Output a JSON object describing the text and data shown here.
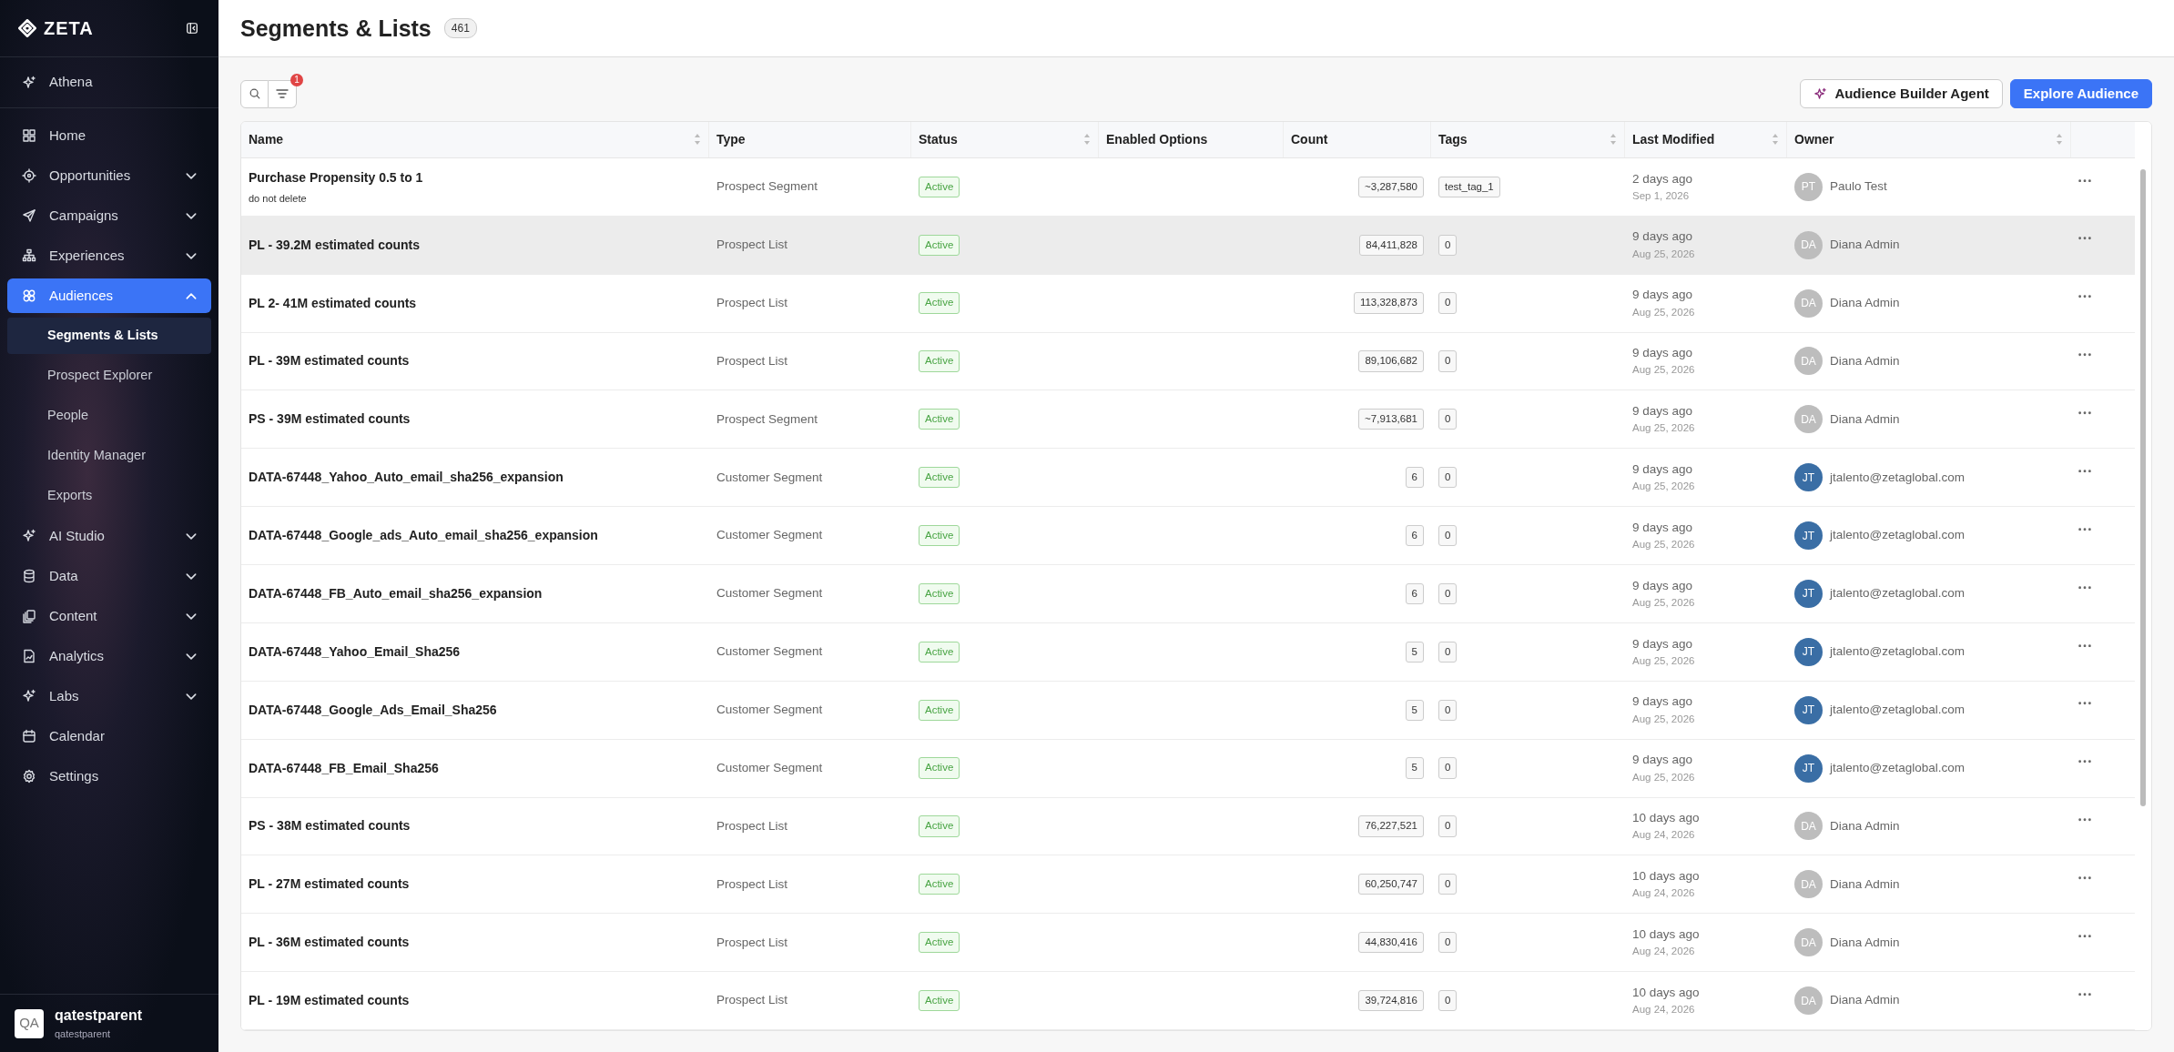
{
  "sidebar": {
    "brand": "ZETA",
    "top_item": {
      "label": "Athena"
    },
    "items": [
      {
        "label": "Home",
        "kind": "link",
        "selected": false
      },
      {
        "label": "Opportunities",
        "kind": "group",
        "expanded": false,
        "selected": false
      },
      {
        "label": "Campaigns",
        "kind": "group",
        "expanded": false,
        "selected": false
      },
      {
        "label": "Experiences",
        "kind": "group",
        "expanded": false,
        "selected": false
      },
      {
        "label": "Audiences",
        "kind": "group",
        "expanded": true,
        "selected": true,
        "children": [
          {
            "label": "Segments & Lists",
            "selected": true
          },
          {
            "label": "Prospect Explorer",
            "selected": false
          },
          {
            "label": "People",
            "selected": false
          },
          {
            "label": "Identity Manager",
            "selected": false
          },
          {
            "label": "Exports",
            "selected": false
          }
        ]
      },
      {
        "label": "AI Studio",
        "kind": "group",
        "expanded": false,
        "selected": false
      },
      {
        "label": "Data",
        "kind": "group",
        "expanded": false,
        "selected": false
      },
      {
        "label": "Content",
        "kind": "group",
        "expanded": false,
        "selected": false
      },
      {
        "label": "Analytics",
        "kind": "group",
        "expanded": false,
        "selected": false
      },
      {
        "label": "Labs",
        "kind": "group",
        "expanded": false,
        "selected": false
      },
      {
        "label": "Calendar",
        "kind": "link",
        "selected": false
      },
      {
        "label": "Settings",
        "kind": "link",
        "selected": false
      }
    ],
    "user": {
      "initials": "QA",
      "name": "qatestparent",
      "org": "qatestparent"
    }
  },
  "page": {
    "title": "Segments & Lists",
    "count": "461",
    "filter_count": "1",
    "buttons": [
      {
        "label": "Audience Builder Agent",
        "kind": "secondary"
      },
      {
        "label": "Explore Audience",
        "kind": "primary"
      }
    ]
  },
  "table": {
    "columns": [
      {
        "label": "Name",
        "sortable": true
      },
      {
        "label": "Type",
        "sortable": false
      },
      {
        "label": "Status",
        "sortable": true
      },
      {
        "label": "Enabled Options",
        "sortable": false
      },
      {
        "label": "Count",
        "sortable": false
      },
      {
        "label": "Tags",
        "sortable": true
      },
      {
        "label": "Last Modified",
        "sortable": true
      },
      {
        "label": "Owner",
        "sortable": true
      }
    ],
    "rows": [
      {
        "name": "Purchase Propensity 0.5 to 1",
        "note": "do not delete",
        "type": "Prospect Segment",
        "status": "Active",
        "count": "~3,287,580",
        "tag": "test_tag_1",
        "modified": "2 days ago",
        "date": "Sep 1, 2026",
        "initials": "PT",
        "owner": "Paulo Test",
        "color": "#bdbdbd",
        "hovered": false
      },
      {
        "name": "PL - 39.2M estimated counts",
        "type": "Prospect List",
        "status": "Active",
        "count": "84,411,828",
        "tag": "0",
        "modified": "9 days ago",
        "date": "Aug 25, 2026",
        "initials": "DA",
        "owner": "Diana Admin",
        "color": "#bdbdbd",
        "hovered": true
      },
      {
        "name": "PL 2- 41M estimated counts",
        "type": "Prospect List",
        "status": "Active",
        "count": "113,328,873",
        "tag": "0",
        "modified": "9 days ago",
        "date": "Aug 25, 2026",
        "initials": "DA",
        "owner": "Diana Admin",
        "color": "#bdbdbd",
        "hovered": false
      },
      {
        "name": "PL - 39M estimated counts",
        "type": "Prospect List",
        "status": "Active",
        "count": "89,106,682",
        "tag": "0",
        "modified": "9 days ago",
        "date": "Aug 25, 2026",
        "initials": "DA",
        "owner": "Diana Admin",
        "color": "#bdbdbd",
        "hovered": false
      },
      {
        "name": "PS - 39M estimated counts",
        "type": "Prospect Segment",
        "status": "Active",
        "count": "~7,913,681",
        "tag": "0",
        "modified": "9 days ago",
        "date": "Aug 25, 2026",
        "initials": "DA",
        "owner": "Diana Admin",
        "color": "#bdbdbd",
        "hovered": false
      },
      {
        "name": "DATA-67448_Yahoo_Auto_email_sha256_expansion",
        "type": "Customer Segment",
        "status": "Active",
        "count": "6",
        "tag": "0",
        "modified": "9 days ago",
        "date": "Aug 25, 2026",
        "initials": "JT",
        "owner": "jtalento@zetaglobal.com",
        "color": "#3a6ea5",
        "hovered": false
      },
      {
        "name": "DATA-67448_Google_ads_Auto_email_sha256_expansion",
        "type": "Customer Segment",
        "status": "Active",
        "count": "6",
        "tag": "0",
        "modified": "9 days ago",
        "date": "Aug 25, 2026",
        "initials": "JT",
        "owner": "jtalento@zetaglobal.com",
        "color": "#3a6ea5",
        "hovered": false
      },
      {
        "name": "DATA-67448_FB_Auto_email_sha256_expansion",
        "type": "Customer Segment",
        "status": "Active",
        "count": "6",
        "tag": "0",
        "modified": "9 days ago",
        "date": "Aug 25, 2026",
        "initials": "JT",
        "owner": "jtalento@zetaglobal.com",
        "color": "#3a6ea5",
        "hovered": false
      },
      {
        "name": "DATA-67448_Yahoo_Email_Sha256",
        "type": "Customer Segment",
        "status": "Active",
        "count": "5",
        "tag": "0",
        "modified": "9 days ago",
        "date": "Aug 25, 2026",
        "initials": "JT",
        "owner": "jtalento@zetaglobal.com",
        "color": "#3a6ea5",
        "hovered": false
      },
      {
        "name": "DATA-67448_Google_Ads_Email_Sha256",
        "type": "Customer Segment",
        "status": "Active",
        "count": "5",
        "tag": "0",
        "modified": "9 days ago",
        "date": "Aug 25, 2026",
        "initials": "JT",
        "owner": "jtalento@zetaglobal.com",
        "color": "#3a6ea5",
        "hovered": false
      },
      {
        "name": "DATA-67448_FB_Email_Sha256",
        "type": "Customer Segment",
        "status": "Active",
        "count": "5",
        "tag": "0",
        "modified": "9 days ago",
        "date": "Aug 25, 2026",
        "initials": "JT",
        "owner": "jtalento@zetaglobal.com",
        "color": "#3a6ea5",
        "hovered": false
      },
      {
        "name": "PS - 38M estimated counts",
        "type": "Prospect List",
        "status": "Active",
        "count": "76,227,521",
        "tag": "0",
        "modified": "10 days ago",
        "date": "Aug 24, 2026",
        "initials": "DA",
        "owner": "Diana Admin",
        "color": "#bdbdbd",
        "hovered": false
      },
      {
        "name": "PL - 27M estimated counts",
        "type": "Prospect List",
        "status": "Active",
        "count": "60,250,747",
        "tag": "0",
        "modified": "10 days ago",
        "date": "Aug 24, 2026",
        "initials": "DA",
        "owner": "Diana Admin",
        "color": "#bdbdbd",
        "hovered": false
      },
      {
        "name": "PL - 36M estimated counts",
        "type": "Prospect List",
        "status": "Active",
        "count": "44,830,416",
        "tag": "0",
        "modified": "10 days ago",
        "date": "Aug 24, 2026",
        "initials": "DA",
        "owner": "Diana Admin",
        "color": "#bdbdbd",
        "hovered": false
      },
      {
        "name": "PL - 19M estimated counts",
        "type": "Prospect List",
        "status": "Active",
        "count": "39,724,816",
        "tag": "0",
        "modified": "10 days ago",
        "date": "Aug 24, 2026",
        "initials": "DA",
        "owner": "Diana Admin",
        "color": "#bdbdbd",
        "hovered": false
      }
    ]
  }
}
